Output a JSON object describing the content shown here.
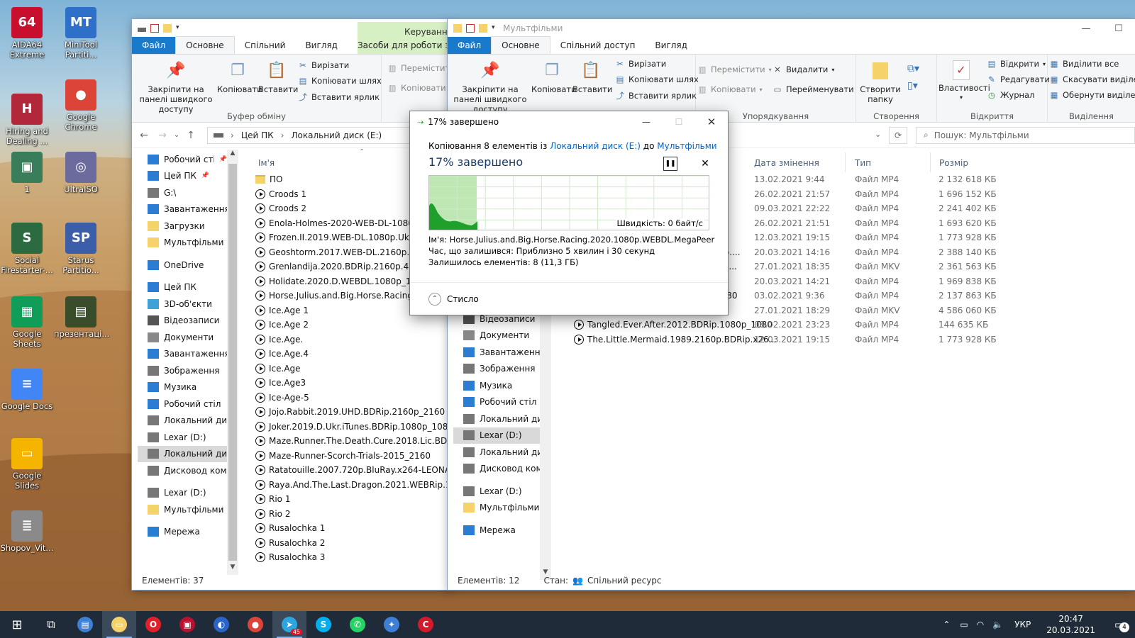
{
  "desktop": {
    "icons": [
      {
        "label": "AIDA64 Extreme",
        "color": "#c8102e",
        "glyph": "64"
      },
      {
        "label": "MiniTool Partiti...",
        "color": "#2e6fc9",
        "glyph": "MT"
      },
      {
        "label": "Hiring and Dealing ...",
        "color": "#b2283a",
        "glyph": "H"
      },
      {
        "label": "Google Chrome",
        "color": "#db4437",
        "glyph": "●"
      },
      {
        "label": "1",
        "color": "#3a7d5a",
        "glyph": "▣"
      },
      {
        "label": "UltraISO",
        "color": "#6b6b9e",
        "glyph": "◎"
      },
      {
        "label": "Social Firestarter-...",
        "color": "#2c6b3f",
        "glyph": "S"
      },
      {
        "label": "Starus Partitio...",
        "color": "#3c5ea8",
        "glyph": "SP"
      },
      {
        "label": "Google Sheets",
        "color": "#0f9d58",
        "glyph": "▦"
      },
      {
        "label": "презентаці...",
        "color": "#3a4d2a",
        "glyph": "▤"
      },
      {
        "label": "Google Docs",
        "color": "#4285f4",
        "glyph": "≡"
      },
      {
        "label": "Google Slides",
        "color": "#f4b400",
        "glyph": "▭"
      },
      {
        "label": "Shopov_Vit...",
        "color": "#8a8a8a",
        "glyph": "≣"
      }
    ]
  },
  "left_window": {
    "contextual_group": "Керування",
    "contextual_tab": "Засоби для роботи з",
    "tabs": [
      "Файл",
      "Основне",
      "Спільний доступ",
      "Вигляд"
    ],
    "ribbon": {
      "pin": "Закріпити на панелі швидкого доступу",
      "copy": "Копіювати",
      "paste": "Вставити",
      "cut": "Вирізати",
      "copy_path": "Копіювати шлях",
      "paste_shortcut": "Вставити ярлик",
      "group_clipboard": "Буфер обміну",
      "move_to": "Перемістити",
      "copy_to": "Копіювати"
    },
    "breadcrumb": [
      "Цей ПК",
      "Локальний диск (E:)"
    ],
    "column_name": "Ім'я",
    "nav": [
      {
        "label": "Робочий стіл",
        "icon": "#2b7cd3",
        "pin": true
      },
      {
        "label": "Цей ПК",
        "icon": "#2b7cd3",
        "pin": true
      },
      {
        "label": "G:\\",
        "icon": "#777"
      },
      {
        "label": "Завантаження",
        "icon": "#2b7cd3"
      },
      {
        "label": "Загрузки",
        "icon": "#f6d26a"
      },
      {
        "label": "Мультфільми",
        "icon": "#f6d26a"
      },
      {
        "label": "",
        "icon": ""
      },
      {
        "label": "OneDrive",
        "icon": "#2b7cd3"
      },
      {
        "label": "",
        "icon": ""
      },
      {
        "label": "Цей ПК",
        "icon": "#2b7cd3"
      },
      {
        "label": "3D-об'єкти",
        "icon": "#3fa1d8"
      },
      {
        "label": "Відеозаписи",
        "icon": "#555"
      },
      {
        "label": "Документи",
        "icon": "#888"
      },
      {
        "label": "Завантаження",
        "icon": "#2b7cd3"
      },
      {
        "label": "Зображення",
        "icon": "#777"
      },
      {
        "label": "Музика",
        "icon": "#2b7cd3"
      },
      {
        "label": "Робочий стіл",
        "icon": "#2b7cd3"
      },
      {
        "label": "Локальний диск",
        "icon": "#777"
      },
      {
        "label": "Lexar (D:)",
        "icon": "#777"
      },
      {
        "label": "Локальний диск",
        "icon": "#777",
        "selected": true
      },
      {
        "label": "Дисковод комп",
        "icon": "#777"
      },
      {
        "label": "",
        "icon": ""
      },
      {
        "label": "Lexar (D:)",
        "icon": "#777"
      },
      {
        "label": "Мультфільми",
        "icon": "#f6d26a"
      },
      {
        "label": "",
        "icon": ""
      },
      {
        "label": "Мережа",
        "icon": "#2b7cd3"
      }
    ],
    "files": [
      {
        "name": "ПО",
        "type": "folder"
      },
      {
        "name": "Croods 1",
        "type": "video"
      },
      {
        "name": "Croods 2",
        "type": "video"
      },
      {
        "name": "Enola-Holmes-2020-WEB-DL-1080p-",
        "type": "video"
      },
      {
        "name": "Frozen.II.2019.WEB-DL.1080p.Ukr_108",
        "type": "video"
      },
      {
        "name": "Geoshtorm.2017.WEB-DL.2160p.HDR",
        "type": "video"
      },
      {
        "name": "Grenlandija.2020.BDRip.2160p.4K.SDR",
        "type": "video"
      },
      {
        "name": "Holidate.2020.D.WEBDL.1080p_1080",
        "type": "video"
      },
      {
        "name": "Horse.Julius.and.Big.Horse.Racing.20",
        "type": "video"
      },
      {
        "name": "Ice.Age 1",
        "type": "video"
      },
      {
        "name": "Ice.Age 2",
        "type": "video"
      },
      {
        "name": "Ice.Age.",
        "type": "video"
      },
      {
        "name": "Ice.Age.4",
        "type": "video"
      },
      {
        "name": "Ice.Age",
        "type": "video"
      },
      {
        "name": "Ice.Age3",
        "type": "video"
      },
      {
        "name": "Ice-Age-5",
        "type": "video"
      },
      {
        "name": "Jojo.Rabbit.2019.UHD.BDRip.2160p_2160",
        "type": "video"
      },
      {
        "name": "Joker.2019.D.Ukr.iTunes.BDRip.1080p_1080",
        "type": "video"
      },
      {
        "name": "Maze.Runner.The.Death.Cure.2018.Lic.BDRip.10",
        "type": "video"
      },
      {
        "name": "Maze-Runner-Scorch-Trials-2015_2160",
        "type": "video"
      },
      {
        "name": "Ratatouille.2007.720p.BluRay.x264-LEONARDO_",
        "type": "video"
      },
      {
        "name": "Raya.And.The.Last.Dragon.2021.WEBRip.1080p.",
        "type": "video"
      },
      {
        "name": "Rio 1",
        "type": "video"
      },
      {
        "name": "Rio 2",
        "type": "video"
      },
      {
        "name": "Rusalochka 1",
        "type": "video"
      },
      {
        "name": "Rusalochka 2",
        "type": "video"
      },
      {
        "name": "Rusalochka 3",
        "type": "video"
      }
    ],
    "status": "Елементів: 37"
  },
  "right_window": {
    "title": "Мультфільми",
    "tabs": [
      "Файл",
      "Основне",
      "Спільний доступ",
      "Вигляд"
    ],
    "ribbon": {
      "pin": "Закріпити на панелі швидкого доступу",
      "copy": "Копіювати",
      "paste": "Вставити",
      "cut": "Вирізати",
      "copy_path": "Копіювати шлях",
      "paste_shortcut": "Вставити ярлик",
      "move_to": "Перемістити",
      "copy_to": "Копіювати",
      "delete": "Видалити",
      "rename": "Перейменувати",
      "group_organize": "Упорядкування",
      "new_folder": "Створити папку",
      "group_create": "Створення",
      "properties": "Властивості",
      "open": "Відкрити",
      "edit": "Редагувати",
      "history": "Журнал",
      "group_open": "Відкриття",
      "select_all": "Виділити все",
      "select_none": "Скасувати виділенн",
      "invert": "Обернути виділенн",
      "group_select": "Виділення"
    },
    "search_placeholder": "Пошук: Мультфільми",
    "columns": [
      "Дата змінення",
      "Тип",
      "Розмір"
    ],
    "rows": [
      {
        "name": "",
        "date": "13.02.2021 9:44",
        "type": "Файл MP4",
        "size": "2 132 618 КБ"
      },
      {
        "name": "",
        "date": "26.02.2021 21:57",
        "type": "Файл MP4",
        "size": "1 696 152 КБ"
      },
      {
        "name": "",
        "date": "09.03.2021 22:22",
        "type": "Файл MP4",
        "size": "2 241 402 КБ"
      },
      {
        "name": "",
        "date": "26.02.2021 21:51",
        "type": "Файл MP4",
        "size": "1 693 620 КБ"
      },
      {
        "name": "",
        "date": "12.03.2021 19:15",
        "type": "Файл MP4",
        "size": "1 773 928 КБ"
      },
      {
        "name": "Rip....",
        "date": "20.03.2021 14:16",
        "type": "Файл MP4",
        "size": "2 388 140 КБ"
      },
      {
        "name": "ON...",
        "date": "27.01.2021 18:35",
        "type": "Файл MKV",
        "size": "2 361 563 КБ"
      },
      {
        "name": "p...",
        "date": "20.03.2021 14:21",
        "type": "Файл MP4",
        "size": "1 969 838 КБ"
      },
      {
        "name": "1080",
        "date": "03.02.2021 9:36",
        "type": "Файл MP4",
        "size": "2 137 863 КБ"
      },
      {
        "name": "Tangled.2010.BDRip.1080p.Rus",
        "date": "27.01.2021 18:29",
        "type": "Файл MKV",
        "size": "4 586 060 КБ"
      },
      {
        "name": "Tangled.Ever.After.2012.BDRip.1080p_1080",
        "date": "08.02.2021 23:23",
        "type": "Файл MP4",
        "size": "144 635 КБ"
      },
      {
        "name": "The.Little.Mermaid.1989.2160p.BDRip.x26...",
        "date": "12.03.2021 19:15",
        "type": "Файл MP4",
        "size": "1 773 928 КБ"
      }
    ],
    "nav": [
      {
        "label": "Відеозаписи",
        "icon": "#555"
      },
      {
        "label": "Документи",
        "icon": "#888"
      },
      {
        "label": "Завантаження",
        "icon": "#2b7cd3"
      },
      {
        "label": "Зображення",
        "icon": "#777"
      },
      {
        "label": "Музика",
        "icon": "#2b7cd3"
      },
      {
        "label": "Робочий стіл",
        "icon": "#2b7cd3"
      },
      {
        "label": "Локальний диск",
        "icon": "#777"
      },
      {
        "label": "Lexar (D:)",
        "icon": "#777",
        "selected": true
      },
      {
        "label": "Локальний диск",
        "icon": "#777"
      },
      {
        "label": "Дисковод комп",
        "icon": "#777"
      },
      {
        "label": "",
        "icon": ""
      },
      {
        "label": "Lexar (D:)",
        "icon": "#777"
      },
      {
        "label": "Мультфільми",
        "icon": "#f6d26a"
      },
      {
        "label": "",
        "icon": ""
      },
      {
        "label": "Мережа",
        "icon": "#2b7cd3"
      }
    ],
    "status_count": "Елементів: 12",
    "status_state": "Стан:",
    "status_shared": "Спільний ресурс"
  },
  "copy_dialog": {
    "title": "17% завершено",
    "copy_prefix": "Копіювання 8 елементів із",
    "source": "Локальний диск (E:)",
    "to": "до",
    "destination": "Мультфільми",
    "heading": "17% завершено",
    "progress_fraction": 0.17,
    "speed": "Швидкість: 0 байт/с",
    "name_label": "Ім'я:",
    "name_value": "Horse.Julius.and.Big.Horse.Racing.2020.1080p.WEBDL.MegaPeer",
    "time_label": "Час, що залишився:",
    "time_value": "Приблизно 5 хвилин і 30 секунд",
    "remaining_label": "Залишилось елементів:",
    "remaining_value": "8 (11,3 ГБ)",
    "less_details": "Стисло",
    "accent": "#06b025"
  },
  "taskbar": {
    "apps": [
      {
        "name": "task-view",
        "glyph": "⧉",
        "color": ""
      },
      {
        "name": "explorer-alt",
        "glyph": "▤",
        "color": "#3d7fd6"
      },
      {
        "name": "file-explorer",
        "glyph": "▭",
        "color": "#f6d26a",
        "active": true
      },
      {
        "name": "opera",
        "glyph": "O",
        "color": "#e3202a"
      },
      {
        "name": "app-red",
        "glyph": "▣",
        "color": "#b8102e"
      },
      {
        "name": "app-headphones",
        "glyph": "◐",
        "color": "#2a64c8"
      },
      {
        "name": "chrome",
        "glyph": "●",
        "color": "#db4437"
      },
      {
        "name": "telegram",
        "glyph": "➤",
        "color": "#2ca5e0",
        "badge": "45",
        "active": true
      },
      {
        "name": "skype",
        "glyph": "S",
        "color": "#00aff0"
      },
      {
        "name": "whatsapp",
        "glyph": "✆",
        "color": "#25d366"
      },
      {
        "name": "app-blue",
        "glyph": "✦",
        "color": "#3d7fd6"
      },
      {
        "name": "app-c",
        "glyph": "C",
        "color": "#d11a2a"
      }
    ],
    "lang": "УКР",
    "time": "20:47",
    "date": "20.03.2021",
    "notifications": "4"
  }
}
